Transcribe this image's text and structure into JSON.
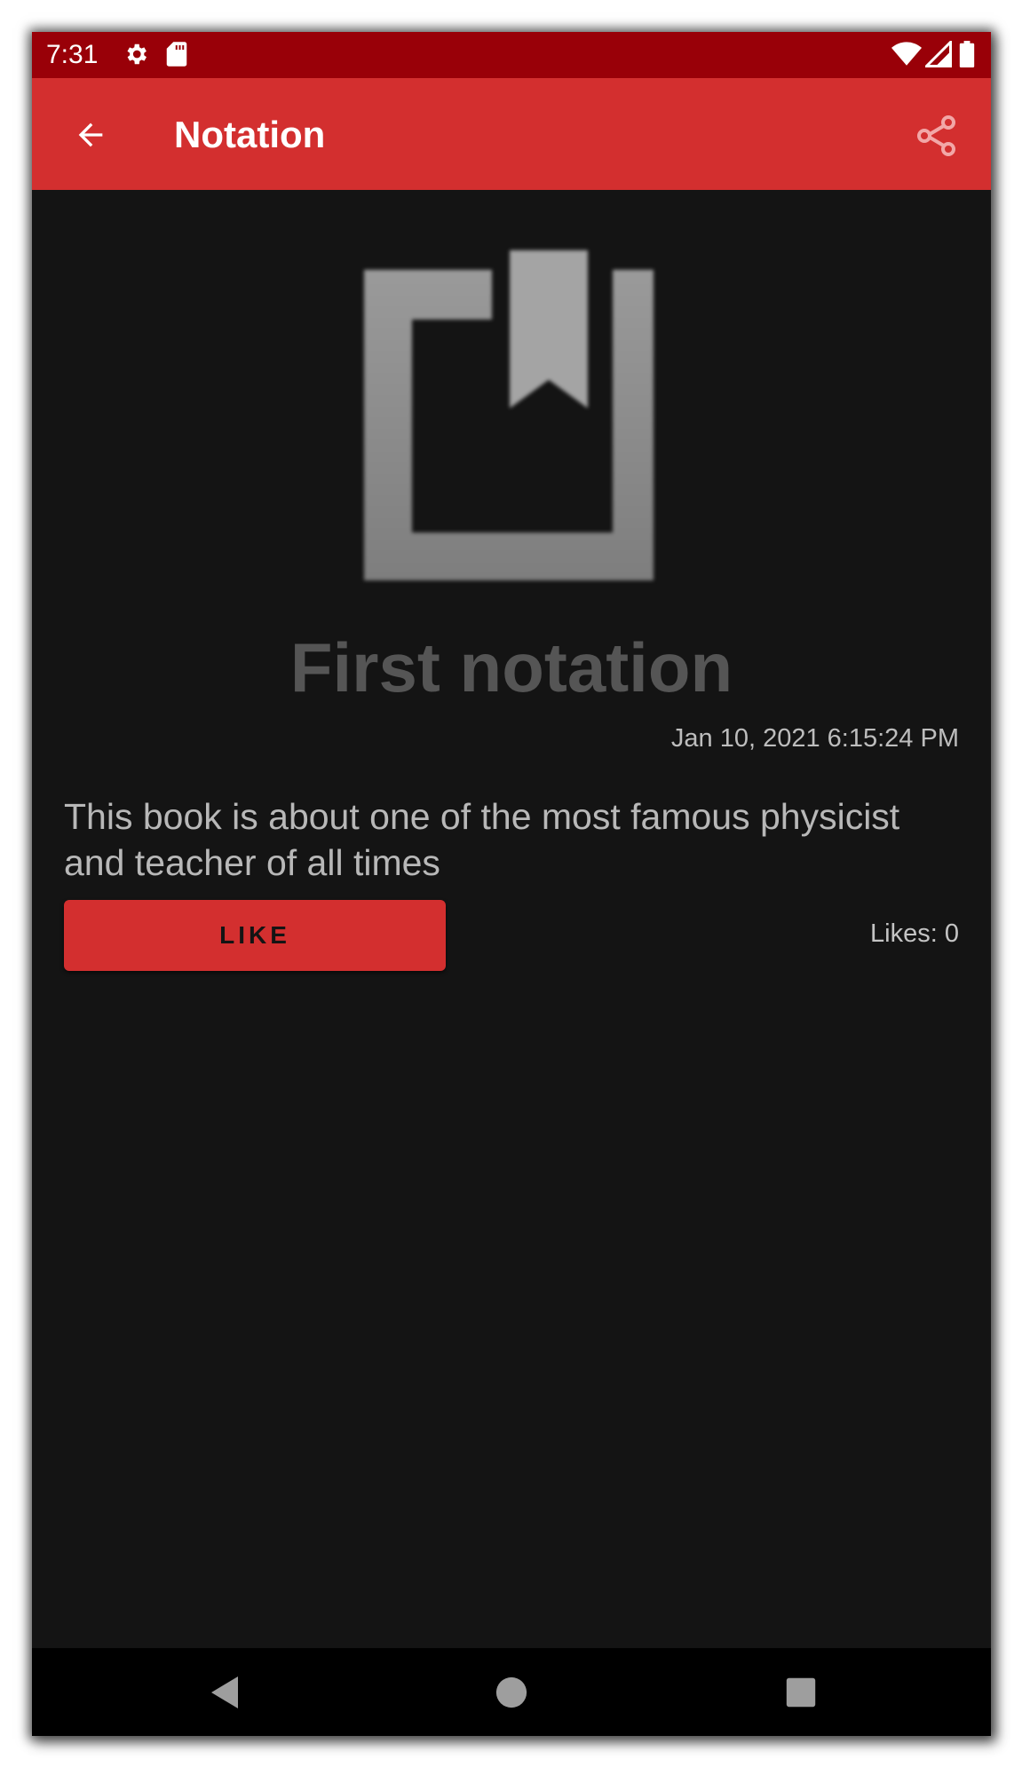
{
  "status_bar": {
    "time": "7:31",
    "icons": [
      "settings-icon",
      "sd-card-icon",
      "wifi-icon",
      "signal-icon",
      "battery-icon"
    ]
  },
  "app_bar": {
    "title": "Notation",
    "back_icon": "arrow-back-icon",
    "share_icon": "share-icon"
  },
  "notation": {
    "image_icon": "bookmark-icon",
    "title": "First notation",
    "date": "Jan 10, 2021 6:15:24 PM",
    "text": "This book is about one of the most famous physicist and teacher of all times",
    "like_label": "LIKE",
    "likes_text": "Likes: 0"
  },
  "nav_bar": {
    "icons": [
      "back-triangle-icon",
      "home-circle-icon",
      "recents-square-icon"
    ]
  },
  "colors": {
    "status_bar": "#990008",
    "accent": "#d32f2f",
    "background": "#141414",
    "title_text": "#555555"
  }
}
